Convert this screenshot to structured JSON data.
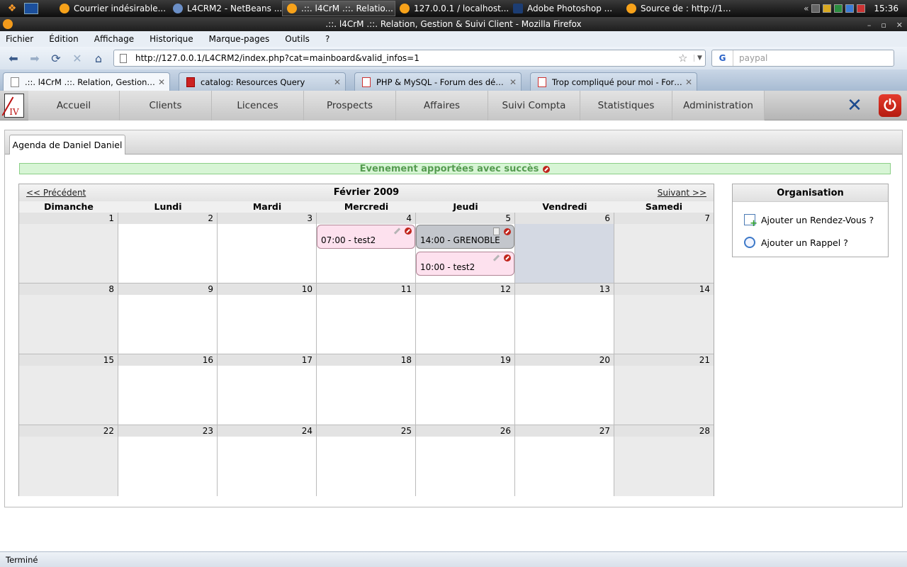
{
  "taskbar": {
    "tasks": [
      {
        "label": "Courrier indésirable..."
      },
      {
        "label": "L4CRM2 - NetBeans ..."
      },
      {
        "label": ".::. l4CrM .::. Relatio..."
      },
      {
        "label": "127.0.0.1 / localhost..."
      },
      {
        "label": "Adobe Photoshop ..."
      },
      {
        "label": "Source de : http://1..."
      }
    ],
    "clock": "15:36"
  },
  "window": {
    "title": ".::. l4CrM .::. Relation, Gestion & Suivi Client - Mozilla Firefox"
  },
  "menu": [
    "Fichier",
    "Édition",
    "Affichage",
    "Historique",
    "Marque-pages",
    "Outils",
    "?"
  ],
  "nav": {
    "url": "http://127.0.0.1/L4CRM2/index.php?cat=mainboard&valid_infos=1",
    "search_placeholder": "paypal",
    "search_engine": "G"
  },
  "tabs": [
    {
      "label": ".::. l4CrM .::. Relation, Gestion & S..."
    },
    {
      "label": "catalog: Resources Query"
    },
    {
      "label": "PHP & MySQL - Forum des développ..."
    },
    {
      "label": "Trop compliqué pour moi - Forum de..."
    }
  ],
  "app": {
    "logo_text": "IV",
    "nav": [
      "Accueil",
      "Clients",
      "Licences",
      "Prospects",
      "Affaires",
      "Suivi Compta",
      "Statistiques",
      "Administration"
    ]
  },
  "panel": {
    "tab_label": "Agenda de Daniel Daniel",
    "success_message": "Evenement apportées avec succès"
  },
  "calendar": {
    "prev": "<< Précédent",
    "next": "Suivant >>",
    "month": "Février 2009",
    "weekdays": [
      "Dimanche",
      "Lundi",
      "Mardi",
      "Mercredi",
      "Jeudi",
      "Vendredi",
      "Samedi"
    ],
    "weeks": [
      [
        "1",
        "2",
        "3",
        "4",
        "5",
        "6",
        "7"
      ],
      [
        "8",
        "9",
        "10",
        "11",
        "12",
        "13",
        "14"
      ],
      [
        "15",
        "16",
        "17",
        "18",
        "19",
        "20",
        "21"
      ],
      [
        "22",
        "23",
        "24",
        "25",
        "26",
        "27",
        "28"
      ]
    ],
    "events": [
      {
        "day": "4",
        "text": "07:00 - test2",
        "color": "#fde1ee"
      },
      {
        "day": "5",
        "text": "14:00 - GRENOBLE",
        "color": "#c3c6cc"
      },
      {
        "day": "5",
        "text": "10:00 - test2",
        "color": "#fde1ee"
      }
    ]
  },
  "organisation": {
    "title": "Organisation",
    "add_rdv": "Ajouter un Rendez-Vous ?",
    "add_rappel": "Ajouter un Rappel ?"
  },
  "status": "Terminé"
}
